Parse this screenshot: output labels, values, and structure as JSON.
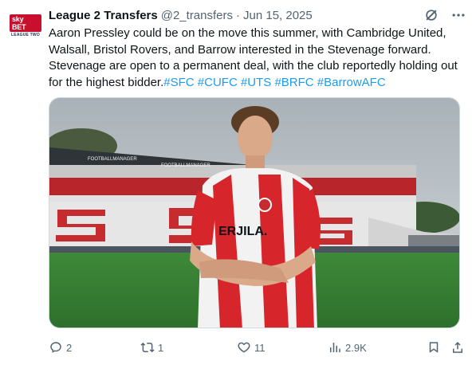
{
  "avatar": {
    "brand": "sky BET",
    "sub": "LEAGUE TWO"
  },
  "header": {
    "name": "League 2 Transfers",
    "handle": "@2_transfers",
    "separator": "·",
    "date": "Jun 15, 2025",
    "grok_icon": "grok-icon",
    "more_icon": "more-dots-icon"
  },
  "tweet": {
    "text": "Aaron Pressley could be on the move this summer, with Cambridge United, Walsall, Bristol Rovers, and Barrow  interested in the Stevenage forward. Stevenage are open to a permanent deal, with the club reportedly holding out for the highest bidder.",
    "hashtags": "#SFC #CUFC #UTS #BRFC #BarrowAFC"
  },
  "media": {
    "stand_sign": "FOOTBALLMANAGER",
    "shirt_sponsor": "ERJILA."
  },
  "footer": {
    "replies": "2",
    "reposts": "1",
    "likes": "11",
    "views": "2.9K"
  },
  "colors": {
    "link": "#1d9bf0",
    "text": "#0f1419",
    "muted": "#536471",
    "kit_red": "#d6252b"
  }
}
